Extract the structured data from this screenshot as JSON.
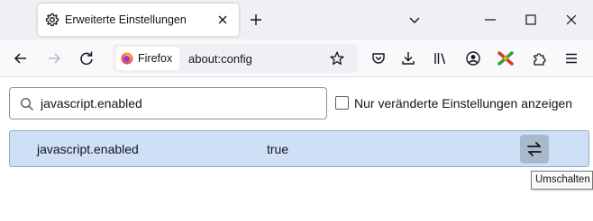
{
  "tab": {
    "title": "Erweiterte Einstellungen",
    "icon": "gear-icon"
  },
  "window_controls": [
    "chevron-down-icon",
    "minimize-icon",
    "maximize-icon",
    "close-icon"
  ],
  "navbar": {
    "identity_label": "Firefox",
    "url": "about:config",
    "toolbar_icons": [
      "pocket-icon",
      "download-icon",
      "library-icon",
      "account-icon",
      "extension-puzzle-colored-icon",
      "extensions-icon",
      "menu-icon"
    ]
  },
  "search": {
    "value": "javascript.enabled",
    "checkbox_label": "Nur veränderte Einstellungen anzeigen",
    "checkbox_checked": false
  },
  "preference": {
    "name": "javascript.enabled",
    "value": "true",
    "toggle_tooltip": "Umschalten"
  },
  "colors": {
    "tabstrip_bg": "#f0f0f4",
    "row_highlight": "#cfe0f6",
    "toggle_bg": "#a9b9cc"
  }
}
